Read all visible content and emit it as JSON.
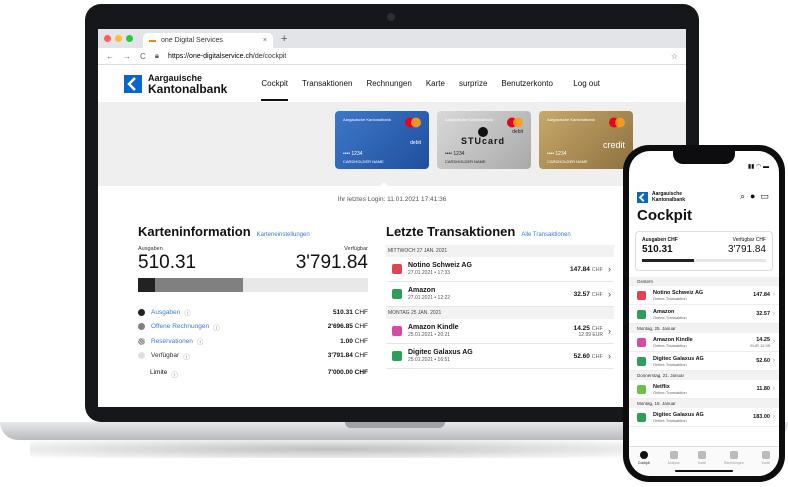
{
  "browser": {
    "tab_title": "one Digital Services",
    "tab_close": "×",
    "new_tab": "+",
    "url_host": "https://one-digitalservice.ch",
    "url_path": "/de/cockpit"
  },
  "header": {
    "logo_line1": "Aargauische",
    "logo_line2": "Kantonalbank",
    "nav": [
      "Cockpit",
      "Transaktionen",
      "Rechnungen",
      "Karte",
      "surprize",
      "Benutzerkonto"
    ],
    "logout": "Log out"
  },
  "cards": [
    {
      "bank": "Aargauische Kantonalbank",
      "number": "•••• 1234",
      "holder": "CARDHOLDER NAME",
      "type": "debit"
    },
    {
      "bank": "Aargauische Kantonalbank",
      "number": "•••• 1234",
      "holder": "CARDHOLDER NAME",
      "type": "debit",
      "brand": "STUcard"
    },
    {
      "bank": "Aargauische Kantonalbank",
      "number": "•••• 1234",
      "holder": "CARDHOLDER NAME",
      "type": "credit"
    }
  ],
  "last_login": "Ihr letztes Login: 11.01.2021 17:41:36",
  "karteninfo": {
    "title": "Karteninformation",
    "settings_link": "Karteneinstellungen",
    "ausgaben_label": "Ausgaben",
    "verfuegbar_label": "Verfügbar",
    "ausgaben_value": "510.31",
    "verfuegbar_value": "3'791.84",
    "bar_spent_fraction": 0.073,
    "bar_open_fraction": 0.384,
    "legend": [
      {
        "label": "Ausgaben",
        "value": "510.31",
        "currency": "CHF",
        "color": "#222222",
        "link": true
      },
      {
        "label": "Offene Rechnungen",
        "value": "2'696.85",
        "currency": "CHF",
        "color": "#808080",
        "link": true
      },
      {
        "label": "Reservationen",
        "value": "1.00",
        "currency": "CHF",
        "color": "#999999",
        "link": true
      },
      {
        "label": "Verfügbar",
        "value": "3'791.84",
        "currency": "CHF",
        "color": "#e0e0e0",
        "link": false
      }
    ],
    "limite_label": "Limite",
    "limite_value": "7'000.00 CHF"
  },
  "transaktionen": {
    "title": "Letzte Transaktionen",
    "all_link": "Alle Transaktionen",
    "groups": [
      {
        "date": "MITTWOCH 27 JAN. 2021",
        "items": [
          {
            "name": "Notino Schweiz AG",
            "date": "27.01.2021 • 17:33",
            "amount": "147.84",
            "currency": "CHF",
            "sub": "",
            "color": "#e0454f"
          },
          {
            "name": "Amazon",
            "date": "27.01.2021 • 12:22",
            "amount": "32.57",
            "currency": "CHF",
            "sub": "",
            "color": "#2f9e58"
          }
        ]
      },
      {
        "date": "MONTAG 25 JAN. 2021",
        "items": [
          {
            "name": "Amazon Kindle",
            "date": "25.01.2021 • 20:21",
            "amount": "14.25",
            "currency": "CHF",
            "sub": "12.99 EUR",
            "color": "#d64aa8"
          },
          {
            "name": "Digitec Galaxus AG",
            "date": "25.01.2021 • 16:51",
            "amount": "52.60",
            "currency": "CHF",
            "sub": "",
            "color": "#2f9e58"
          }
        ]
      }
    ]
  },
  "phone": {
    "logo_line1": "Aargauische",
    "logo_line2": "Kantonalbank",
    "title": "Cockpit",
    "ausgaben_label": "Ausgaben CHF",
    "verfuegbar_label": "Verfügbar CHF",
    "ausgaben_value": "510.31",
    "verfuegbar_value": "3'791.84",
    "sections": [
      {
        "label": "Gestern",
        "rows": [
          {
            "name": "Notino Schweiz AG",
            "sub": "Online-Transaktion",
            "amount": "147.84",
            "amount2": "",
            "color": "#e0454f"
          },
          {
            "name": "Amazon",
            "sub": "Online-Transaktion",
            "amount": "32.57",
            "amount2": "",
            "color": "#2f9e58"
          }
        ]
      },
      {
        "label": "Montag, 25. Januar",
        "rows": [
          {
            "name": "Amazon Kindle",
            "sub": "Online-Transaktion",
            "amount": "14.25",
            "amount2": "EUR 12.99",
            "color": "#d64aa8"
          },
          {
            "name": "Digitec Galaxus AG",
            "sub": "Online-Transaktion",
            "amount": "52.60",
            "amount2": "",
            "color": "#2f9e58"
          }
        ]
      },
      {
        "label": "Donnerstag, 21. Januar",
        "rows": [
          {
            "name": "Netflix",
            "sub": "Online-Transaktion",
            "amount": "11.80",
            "amount2": "",
            "color": "#6cbf4a"
          }
        ]
      },
      {
        "label": "Montag, 18. Januar",
        "rows": [
          {
            "name": "Digitec Galaxus AG",
            "sub": "Online-Transaktion",
            "amount": "183.00",
            "amount2": "",
            "color": "#2f9e58"
          }
        ]
      }
    ],
    "tabs": [
      "Cockpit",
      "Analyse",
      "Karte",
      "Rechnungen",
      "Karte"
    ]
  }
}
